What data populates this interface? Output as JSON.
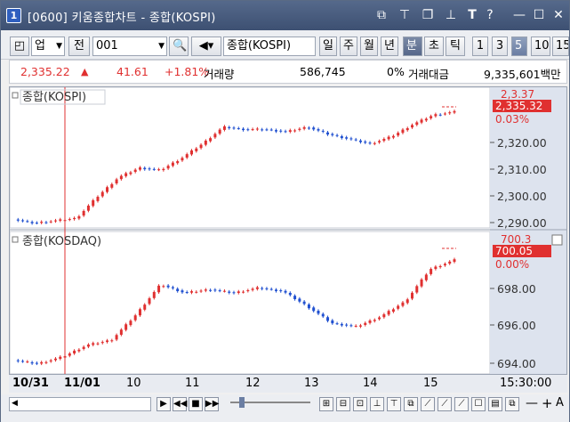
{
  "window": {
    "num": "1",
    "title": "[0600] 키움종합차트 - 종합(KOSPI)"
  },
  "toolbar": {
    "market": "업",
    "jeon": "전",
    "code": "001",
    "name": "종합(KOSPI)",
    "periods": [
      "일",
      "주",
      "월",
      "년",
      "분",
      "초",
      "틱"
    ],
    "intervals": [
      "1",
      "3",
      "5",
      "10",
      "15"
    ]
  },
  "quote": {
    "price": "2,335.22",
    "arrow": "▲",
    "change": "41.61",
    "pct": "+1.81%",
    "vol_label": "거래량",
    "vol": "586,745",
    "vol_pct": "0%",
    "amt_label": "거래대금",
    "amt": "9,335,601백만"
  },
  "panels": [
    {
      "title": "종합(KOSPI)",
      "last": "2,335.32",
      "pct": "0.03%",
      "top_hidden": "2,3.37",
      "ticks": [
        "2,320.00",
        "2,310.00",
        "2,300.00",
        "2,290.00"
      ]
    },
    {
      "title": "종합(KOSDAQ)",
      "last": "700.05",
      "pct": "0.00%",
      "top_hidden": "700.3",
      "ticks": [
        "698.00",
        "696.00",
        "694.00"
      ]
    }
  ],
  "xaxis": {
    "labels": [
      "10/31",
      "11/01",
      "10",
      "11",
      "12",
      "13",
      "14",
      "15"
    ],
    "time": "15:30:00"
  },
  "colors": {
    "up": "#e03030",
    "down": "#2050d0"
  }
}
